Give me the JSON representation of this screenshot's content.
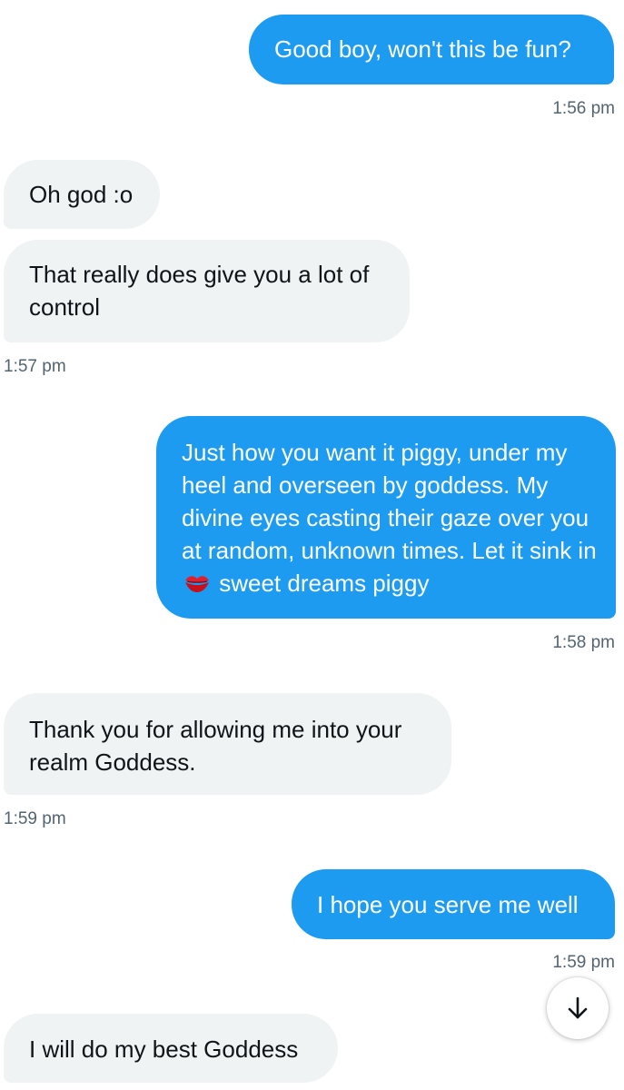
{
  "messages": [
    {
      "text": "Good boy, won't this be fun?",
      "time": "1:56 pm"
    },
    {
      "text": "Oh god :o"
    },
    {
      "text": "That really does give you a lot of control",
      "time": "1:57 pm"
    },
    {
      "text_before": "Just how you want it piggy, under my heel and overseen by goddess. My divine eyes casting their gaze over you at random, unknown times. Let it sink in",
      "emoji": "kiss-mark-icon",
      "text_after": "sweet dreams piggy",
      "time": "1:58 pm"
    },
    {
      "text": "Thank you for allowing me into your realm Goddess.",
      "time": "1:59 pm"
    },
    {
      "text": "I hope you serve me well",
      "time": "1:59 pm"
    },
    {
      "text": "I will do my best Goddess"
    }
  ],
  "scroll_button": {
    "icon": "arrow-down-icon"
  },
  "colors": {
    "sent_bubble": "#1d9bf0",
    "received_bubble": "#eff3f4",
    "timestamp": "#536471",
    "text_dark": "#0f1419"
  }
}
